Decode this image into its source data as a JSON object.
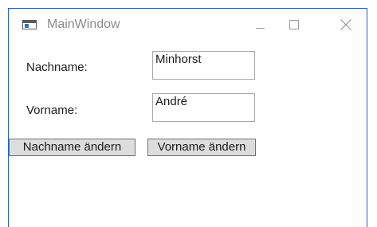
{
  "window": {
    "title": "MainWindow",
    "border_color": "#1e5fcf"
  },
  "titlebar": {
    "icons": [
      "app-window-icon",
      "minimize-icon",
      "maximize-icon",
      "close-icon"
    ]
  },
  "form": {
    "nachname_label": "Nachname:",
    "nachname_value": "Minhorst",
    "vorname_label": "Vorname:",
    "vorname_value": "André"
  },
  "buttons": {
    "change_nachname": "Nachname ändern",
    "change_vorname": "Vorname ändern"
  }
}
